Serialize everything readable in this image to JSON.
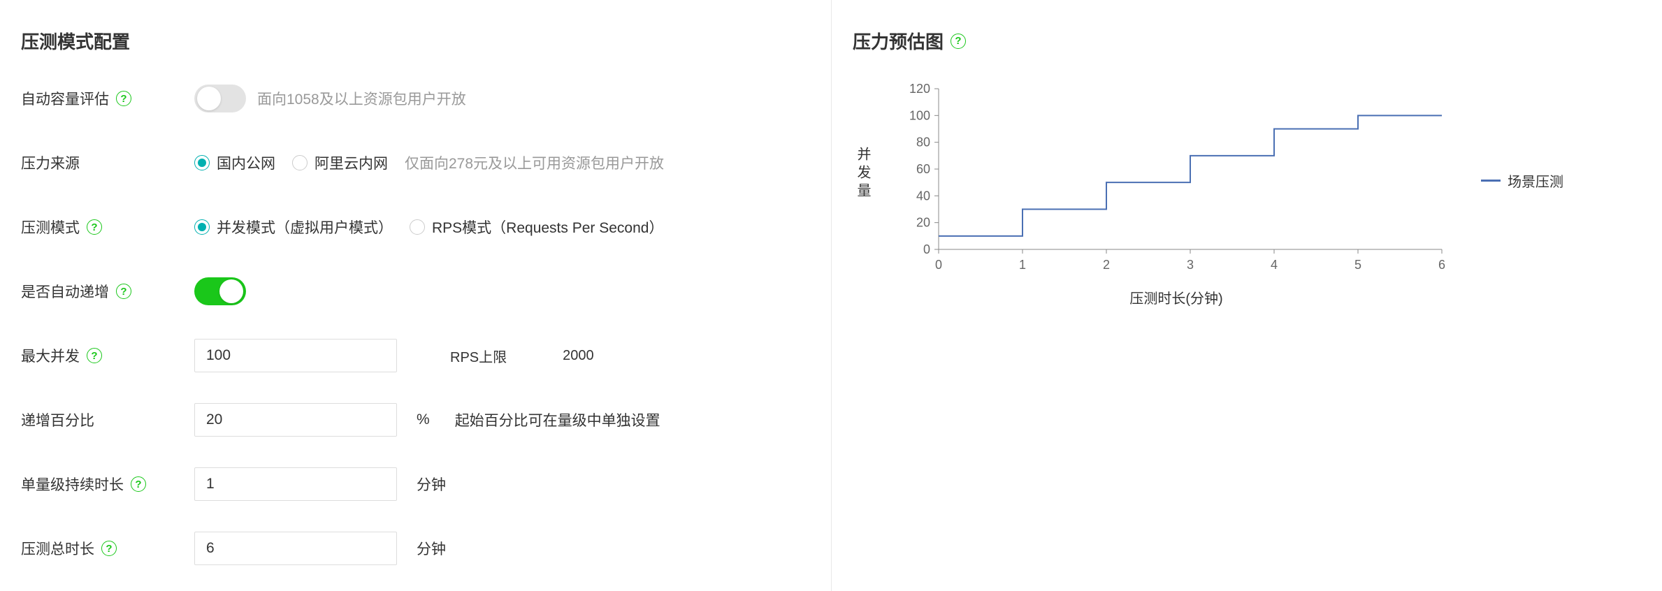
{
  "left": {
    "title": "压测模式配置",
    "auto_capacity": {
      "label": "自动容量评估",
      "enabled": false,
      "hint": "面向1058及以上资源包用户开放"
    },
    "pressure_source": {
      "label": "压力来源",
      "options": [
        {
          "label": "国内公网",
          "selected": true
        },
        {
          "label": "阿里云内网",
          "selected": false
        }
      ],
      "hint": "仅面向278元及以上可用资源包用户开放"
    },
    "pressure_mode": {
      "label": "压测模式",
      "options": [
        {
          "label": "并发模式（虚拟用户模式）",
          "selected": true
        },
        {
          "label": "RPS模式（Requests Per Second）",
          "selected": false
        }
      ]
    },
    "auto_increment": {
      "label": "是否自动递增",
      "enabled": true
    },
    "max_concurrency": {
      "label": "最大并发",
      "value": "100",
      "rps_limit_label": "RPS上限",
      "rps_limit_value": "2000"
    },
    "increment_pct": {
      "label": "递增百分比",
      "value": "20",
      "unit": "%",
      "hint": "起始百分比可在量级中单独设置"
    },
    "step_duration": {
      "label": "单量级持续时长",
      "value": "1",
      "unit": "分钟"
    },
    "total_duration": {
      "label": "压测总时长",
      "value": "6",
      "unit": "分钟"
    }
  },
  "right": {
    "title": "压力预估图",
    "legend": "场景压测",
    "xlabel": "压测时长(分钟)",
    "ylabel": "并发量"
  },
  "chart_data": {
    "type": "line",
    "title": "压力预估图",
    "xlabel": "压测时长(分钟)",
    "ylabel": "并发量",
    "xlim": [
      0,
      6
    ],
    "ylim": [
      0,
      120
    ],
    "x_ticks": [
      0,
      1,
      2,
      3,
      4,
      5,
      6
    ],
    "y_ticks": [
      0,
      20,
      40,
      60,
      80,
      100,
      120
    ],
    "series": [
      {
        "name": "场景压测",
        "step": true,
        "points": [
          {
            "x": 0,
            "y": 10
          },
          {
            "x": 1,
            "y": 10
          },
          {
            "x": 1,
            "y": 30
          },
          {
            "x": 2,
            "y": 30
          },
          {
            "x": 2,
            "y": 50
          },
          {
            "x": 3,
            "y": 50
          },
          {
            "x": 3,
            "y": 70
          },
          {
            "x": 4,
            "y": 70
          },
          {
            "x": 4,
            "y": 90
          },
          {
            "x": 5,
            "y": 90
          },
          {
            "x": 5,
            "y": 100
          },
          {
            "x": 6,
            "y": 100
          }
        ]
      }
    ]
  }
}
